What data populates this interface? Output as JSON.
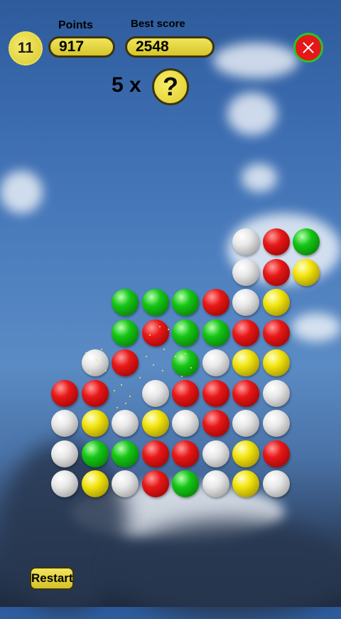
{
  "hud": {
    "level": "11",
    "points_label": "Points",
    "points_value": "917",
    "best_label": "Best score",
    "best_value": "2548",
    "multiplier": "5 x",
    "mystery_symbol": "?"
  },
  "footer": {
    "restart_label": "Restart"
  },
  "colors": {
    "red": "#e81818",
    "green": "#16c616",
    "yellow": "#f2e40e",
    "white": "#e8e8e8",
    "button_yellow": "#f0e45a"
  },
  "board": {
    "columns": 9,
    "rows": 9,
    "cells": [
      [
        null,
        null,
        null,
        null,
        null,
        null,
        "white",
        "red",
        "green"
      ],
      [
        null,
        null,
        null,
        null,
        null,
        null,
        "white",
        "red",
        "yellow"
      ],
      [
        null,
        null,
        "green",
        "green",
        "green",
        "red",
        "white",
        "yellow",
        null
      ],
      [
        null,
        null,
        "green",
        "red",
        "green",
        "green",
        "red",
        "red",
        null
      ],
      [
        null,
        "white",
        "red",
        null,
        "green",
        "white",
        "yellow",
        "yellow",
        null
      ],
      [
        "red",
        "red",
        null,
        "white",
        "red",
        "red",
        "red",
        "white",
        null
      ],
      [
        "white",
        "yellow",
        "white",
        "yellow",
        "white",
        "red",
        "white",
        "white",
        null
      ],
      [
        "white",
        "green",
        "green",
        "red",
        "red",
        "white",
        "yellow",
        "red",
        null
      ],
      [
        "white",
        "yellow",
        "white",
        "red",
        "green",
        "white",
        "yellow",
        "white",
        null
      ]
    ]
  }
}
